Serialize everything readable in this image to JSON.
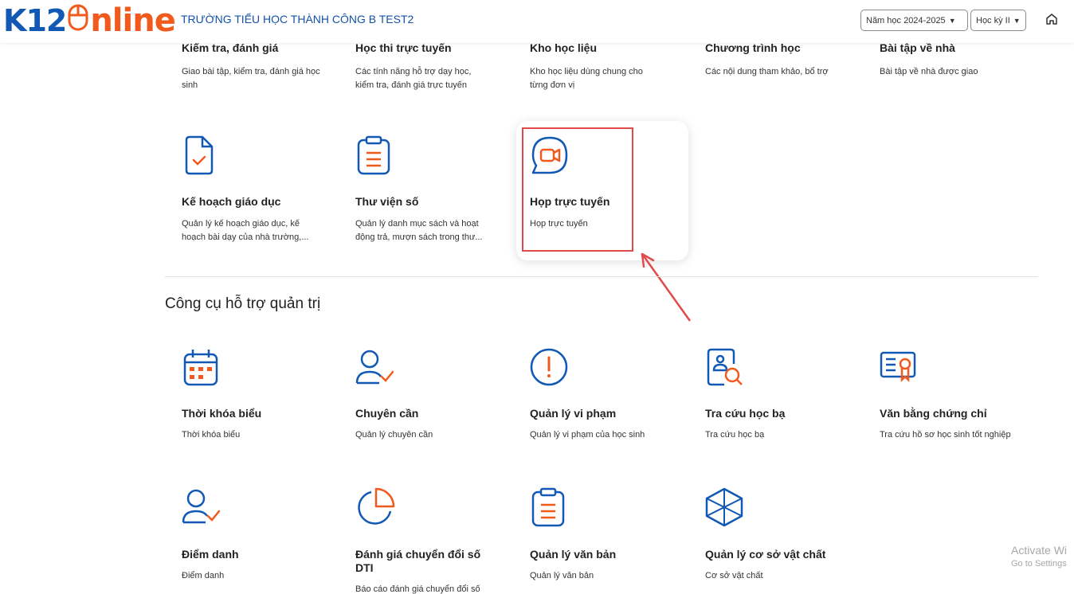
{
  "header": {
    "logo_part1": "K12",
    "logo_part2": "nline",
    "school_name": "TRƯỜNG TIỂU HỌC THÀNH CÔNG B TEST2",
    "year_select": "Năm học 2024-2025",
    "term_select": "Học kỳ II",
    "home_icon": "home-icon"
  },
  "top_row": [
    {
      "title": "Kiểm tra, đánh giá",
      "desc": "Giao bài tập, kiểm tra, đánh giá học sinh"
    },
    {
      "title": "Học thi trực tuyến",
      "desc": "Các tính năng hỗ trợ dạy học, kiểm tra, đánh giá trực tuyến"
    },
    {
      "title": "Kho học liệu",
      "desc": "Kho học liệu dùng chung cho từng đơn vị"
    },
    {
      "title": "Chương trình học",
      "desc": "Các nội dung tham khảo, bổ trợ"
    },
    {
      "title": "Bài tập về nhà",
      "desc": "Bài tập về nhà được giao"
    }
  ],
  "row2": [
    {
      "title": "Kế hoạch giáo dục",
      "desc": "Quản lý kế hoạch giáo dục, kế hoạch bài dạy của nhà trường,...",
      "icon": "document-check-icon"
    },
    {
      "title": "Thư viện số",
      "desc": "Quản lý danh mục sách và hoạt động trả, mượn sách trong thư...",
      "icon": "clipboard-list-icon"
    },
    {
      "title": "Họp trực tuyến",
      "desc": "Họp trực tuyến",
      "icon": "video-chat-icon"
    }
  ],
  "section_admin": "Công cụ hỗ trợ quản trị",
  "admin_row1": [
    {
      "title": "Thời khóa biểu",
      "desc": "Thời khóa biểu",
      "icon": "calendar-icon"
    },
    {
      "title": "Chuyên cần",
      "desc": "Quản lý chuyên cần",
      "icon": "user-check-icon"
    },
    {
      "title": "Quản lý vi phạm",
      "desc": "Quản lý vi phạm của học sinh",
      "icon": "alert-circle-icon"
    },
    {
      "title": "Tra cứu học bạ",
      "desc": "Tra cứu học bạ",
      "icon": "search-profile-icon"
    },
    {
      "title": "Văn bằng chứng chỉ",
      "desc": "Tra cứu hồ sơ học sinh tốt nghiệp",
      "icon": "certificate-icon"
    }
  ],
  "admin_row2": [
    {
      "title": "Điểm danh",
      "desc": "Điểm danh",
      "icon": "user-check-icon"
    },
    {
      "title": "Đánh giá chuyển đổi số DTI",
      "desc": "Báo cáo đánh giá chuyển đổi số",
      "icon": "pie-chart-icon"
    },
    {
      "title": "Quản lý văn bản",
      "desc": "Quản lý văn bản",
      "icon": "clipboard-list-icon"
    },
    {
      "title": "Quản lý cơ sở vật chất",
      "desc": "Cơ sở vật chất",
      "icon": "cube-icon"
    }
  ],
  "watermark": {
    "line1": "Activate Wi",
    "line2": "Go to Settings"
  },
  "colors": {
    "brand_blue": "#1259b5",
    "brand_orange": "#f25a1d",
    "highlight_red": "#e04a4a"
  }
}
